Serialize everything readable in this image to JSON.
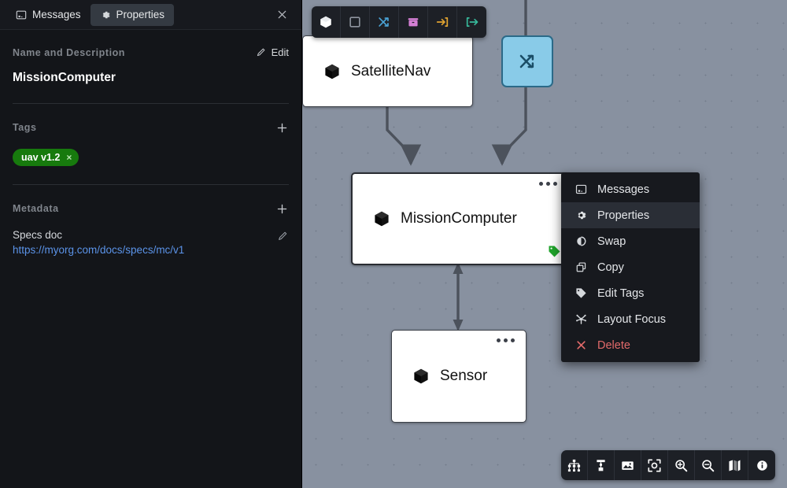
{
  "panel": {
    "tabs": [
      {
        "label": "Messages",
        "icon": "messages-icon",
        "active": false
      },
      {
        "label": "Properties",
        "icon": "gear-icon",
        "active": true
      }
    ],
    "close_label": "Close",
    "sections": {
      "name_and_description": {
        "title": "Name and Description",
        "edit_label": "Edit",
        "value": "MissionComputer"
      },
      "tags": {
        "title": "Tags",
        "add_label": "+",
        "items": [
          {
            "label": "uav v1.2",
            "remove_label": "×",
            "color": "#177a0d"
          }
        ]
      },
      "metadata": {
        "title": "Metadata",
        "add_label": "+",
        "items": [
          {
            "key": "Specs doc",
            "value": "https://myorg.com/docs/specs/mc/v1",
            "link_color": "#5b93e8"
          }
        ]
      }
    }
  },
  "canvas": {
    "background_color": "#8891a0",
    "node_toolbar": [
      {
        "name": "block-icon",
        "title": "Block",
        "color": "#ffffff"
      },
      {
        "name": "frame-icon",
        "title": "Frame",
        "color": "#8e949e"
      },
      {
        "name": "swap-icon",
        "title": "Swap",
        "color": "#4aa3d6"
      },
      {
        "name": "package-icon",
        "title": "Package",
        "color": "#d47fd4"
      },
      {
        "name": "input-port-icon",
        "title": "Input",
        "color": "#e0a331"
      },
      {
        "name": "output-port-icon",
        "title": "Output",
        "color": "#37b89a"
      }
    ],
    "nodes": [
      {
        "id": "satellitenav",
        "label": "SatelliteNav",
        "icon": "cube-icon",
        "type": "block",
        "selected": false,
        "tagged": false
      },
      {
        "id": "missioncomputer",
        "label": "MissionComputer",
        "icon": "cube-icon",
        "type": "block",
        "selected": true,
        "tagged": true,
        "tag_color": "#1fa32b"
      },
      {
        "id": "sensor",
        "label": "Sensor",
        "icon": "cube-icon",
        "type": "block",
        "selected": false,
        "tagged": false
      },
      {
        "id": "swapnode",
        "label": "",
        "icon": "swap-icon",
        "type": "swap",
        "selected": false,
        "tagged": false,
        "fill": "#89cbe8",
        "stroke": "#2b6a88"
      }
    ],
    "bottom_toolbar": [
      {
        "name": "hierarchy-layout-icon",
        "title": "Hierarchy layout"
      },
      {
        "name": "vertical-layout-icon",
        "title": "Vertical layout"
      },
      {
        "name": "image-icon",
        "title": "Export image"
      },
      {
        "name": "fit-to-screen-icon",
        "title": "Fit to screen"
      },
      {
        "name": "zoom-in-icon",
        "title": "Zoom in"
      },
      {
        "name": "zoom-out-icon",
        "title": "Zoom out"
      },
      {
        "name": "minimap-icon",
        "title": "Minimap"
      },
      {
        "name": "info-icon",
        "title": "Info"
      }
    ]
  },
  "context_menu": {
    "items": [
      {
        "label": "Messages",
        "icon": "messages-icon",
        "highlighted": false,
        "danger": false
      },
      {
        "label": "Properties",
        "icon": "gear-icon",
        "highlighted": true,
        "danger": false
      },
      {
        "label": "Swap",
        "icon": "swap-circle-icon",
        "highlighted": false,
        "danger": false
      },
      {
        "label": "Copy",
        "icon": "copy-icon",
        "highlighted": false,
        "danger": false
      },
      {
        "label": "Edit Tags",
        "icon": "tag-icon",
        "highlighted": false,
        "danger": false
      },
      {
        "label": "Layout Focus",
        "icon": "layout-focus-icon",
        "highlighted": false,
        "danger": false
      },
      {
        "label": "Delete",
        "icon": "close-x-icon",
        "highlighted": false,
        "danger": true
      }
    ]
  }
}
